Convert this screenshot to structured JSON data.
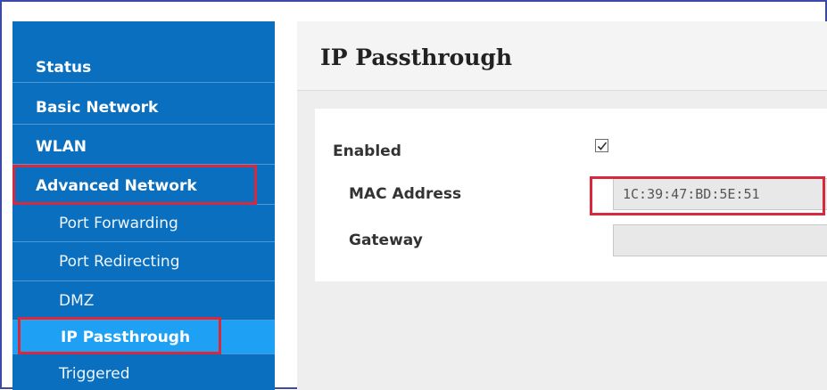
{
  "sidebar": {
    "items": [
      {
        "label": "Status"
      },
      {
        "label": "Basic Network"
      },
      {
        "label": "WLAN"
      },
      {
        "label": "Advanced Network"
      },
      {
        "label": "Port Forwarding"
      },
      {
        "label": "Port Redirecting"
      },
      {
        "label": "DMZ"
      },
      {
        "label": "IP Passthrough"
      },
      {
        "label": "Triggered"
      }
    ]
  },
  "page": {
    "title": "IP Passthrough"
  },
  "form": {
    "enabled_label": "Enabled",
    "enabled_checked": true,
    "mac_label": "MAC Address",
    "mac_value": "1C:39:47:BD:5E:51",
    "gateway_label": "Gateway",
    "gateway_value": ""
  },
  "colors": {
    "sidebar": "#0a6fbf",
    "active_item": "#1ea1f4",
    "highlight": "#d8283c"
  }
}
